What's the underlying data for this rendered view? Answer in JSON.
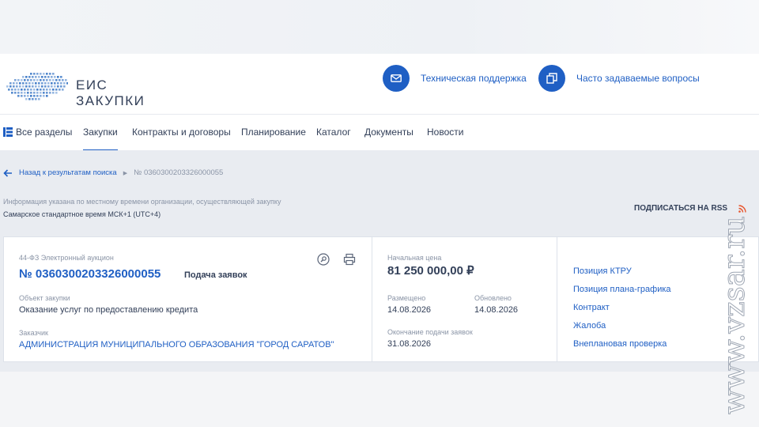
{
  "header": {
    "logo_line1": "ЕИС",
    "logo_line2": "ЗАКУПКИ",
    "support_label": "Техническая поддержка",
    "faq_label": "Часто задаваемые вопросы"
  },
  "nav": {
    "all_sections": "Все разделы",
    "items": [
      "Закупки",
      "Контракты и договоры",
      "Планирование",
      "Каталог",
      "Документы",
      "Новости"
    ]
  },
  "breadcrumb": {
    "back": "Назад к результатам поиска",
    "current": "№ 0360300203326000055"
  },
  "notice": {
    "info": "Информация указана по местному времени организации, осуществляющей закупку",
    "timezone": "Самарское стандартное время МСК+1 (UTC+4)",
    "rss": "ПОДПИСАТЬСЯ НА RSS"
  },
  "purchase": {
    "law_type": "44-ФЗ  Электронный аукцион",
    "number": "№ 0360300203326000055",
    "stage": "Подача заявок",
    "object_label": "Объект закупки",
    "object_value": "Оказание услуг по предоставлению кредита",
    "customer_label": "Заказчик",
    "customer_value": "АДМИНИСТРАЦИЯ МУНИЦИПАЛЬНОГО ОБРАЗОВАНИЯ \"ГОРОД САРАТОВ\"",
    "price_label": "Начальная цена",
    "price_value": "81 250 000,00 ₽",
    "posted_label": "Размещено",
    "posted_value": "14.08.2026",
    "updated_label": "Обновлено",
    "updated_value": "14.08.2026",
    "deadline_label": "Окончание подачи заявок",
    "deadline_value": "31.08.2026"
  },
  "links": [
    "Позиция КТРУ",
    "Позиция плана-графика",
    "Контракт",
    "Жалоба",
    "Внеплановая проверка"
  ],
  "watermark": "www.vzsar.ru",
  "colors": {
    "accent": "#1f5fc4",
    "text": "#334059",
    "muted": "#8a94a6",
    "rss": "#e8542b"
  }
}
